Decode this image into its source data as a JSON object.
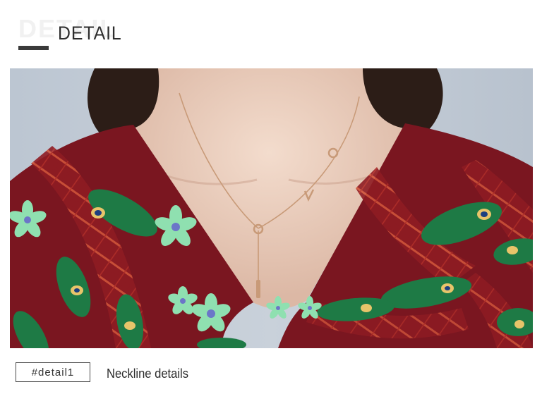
{
  "header": {
    "title": "DETAIL"
  },
  "photo": {
    "subject": "neckline-closeup",
    "colors": {
      "background": "#c3ccd6",
      "skin": "#e9cfbf",
      "hair": "#2c1d17",
      "dress": "#7a1620",
      "feather_red": "#c8402e",
      "feather_green": "#1e7a45",
      "flower": "#8fe0b0",
      "chain": "#c89a78"
    }
  },
  "footer": {
    "tag_label": "#detail1",
    "caption": "Neckline details"
  }
}
